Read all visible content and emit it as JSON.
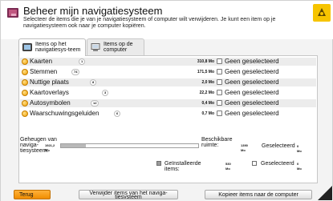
{
  "header": {
    "title": "Beheer mijn navigatiesysteem",
    "subtitle": "Selecteer de items die je van je navigatiesysteem of computer wilt verwijderen. Je kunt een item op je navigatiesysteem ook naar je computer kopiëren."
  },
  "tabs": [
    {
      "label": "Items op het navigatiesys-teem",
      "active": true
    },
    {
      "label": "Items op de computer",
      "active": false
    }
  ],
  "items": [
    {
      "name": "Kaarten",
      "count": "1",
      "size": "310,8 Mo",
      "status": "Geen geselecteerd"
    },
    {
      "name": "Stemmen",
      "count": "74",
      "size": "171,5 Mo",
      "status": "Geen geselecteerd"
    },
    {
      "name": "Nuttige plaats",
      "count": "8",
      "size": "2,0 Mo",
      "status": "Geen geselecteerd"
    },
    {
      "name": "Kaartoverlays",
      "count": "3",
      "size": "22,2 Mo",
      "status": "Geen geselecteerd"
    },
    {
      "name": "Autosymbolen",
      "count": "12",
      "size": "0,4 Mo",
      "status": "Geen geselecteerd"
    },
    {
      "name": "Waarschuwingsgeluiden",
      "count": "6",
      "size": "0,7 Mo",
      "status": "Geen geselecteerd"
    }
  ],
  "summary": {
    "memory_label": "Geheugen van naviga-tiesysteem:",
    "memory_value": "1921,2 Mo",
    "memory_fill_fraction": 0.18,
    "available_label": "Beschikbare ruimte:",
    "available_value": "1390 Mo",
    "selected_label": "Geselecteerd",
    "selected_value": "0 Mo",
    "installed_label": "Geïnstalleerde items:",
    "installed_value": "530 Mo",
    "selected2_label": "Geselecteerd",
    "selected2_value": "0 Mo"
  },
  "buttons": {
    "back": "Terug",
    "delete": "Verwijder items van het naviga-tiesysteem",
    "copy": "Kopieer items naar de computer"
  },
  "colors": {
    "accent": "#f5a000",
    "background": "#f3f3f3"
  }
}
